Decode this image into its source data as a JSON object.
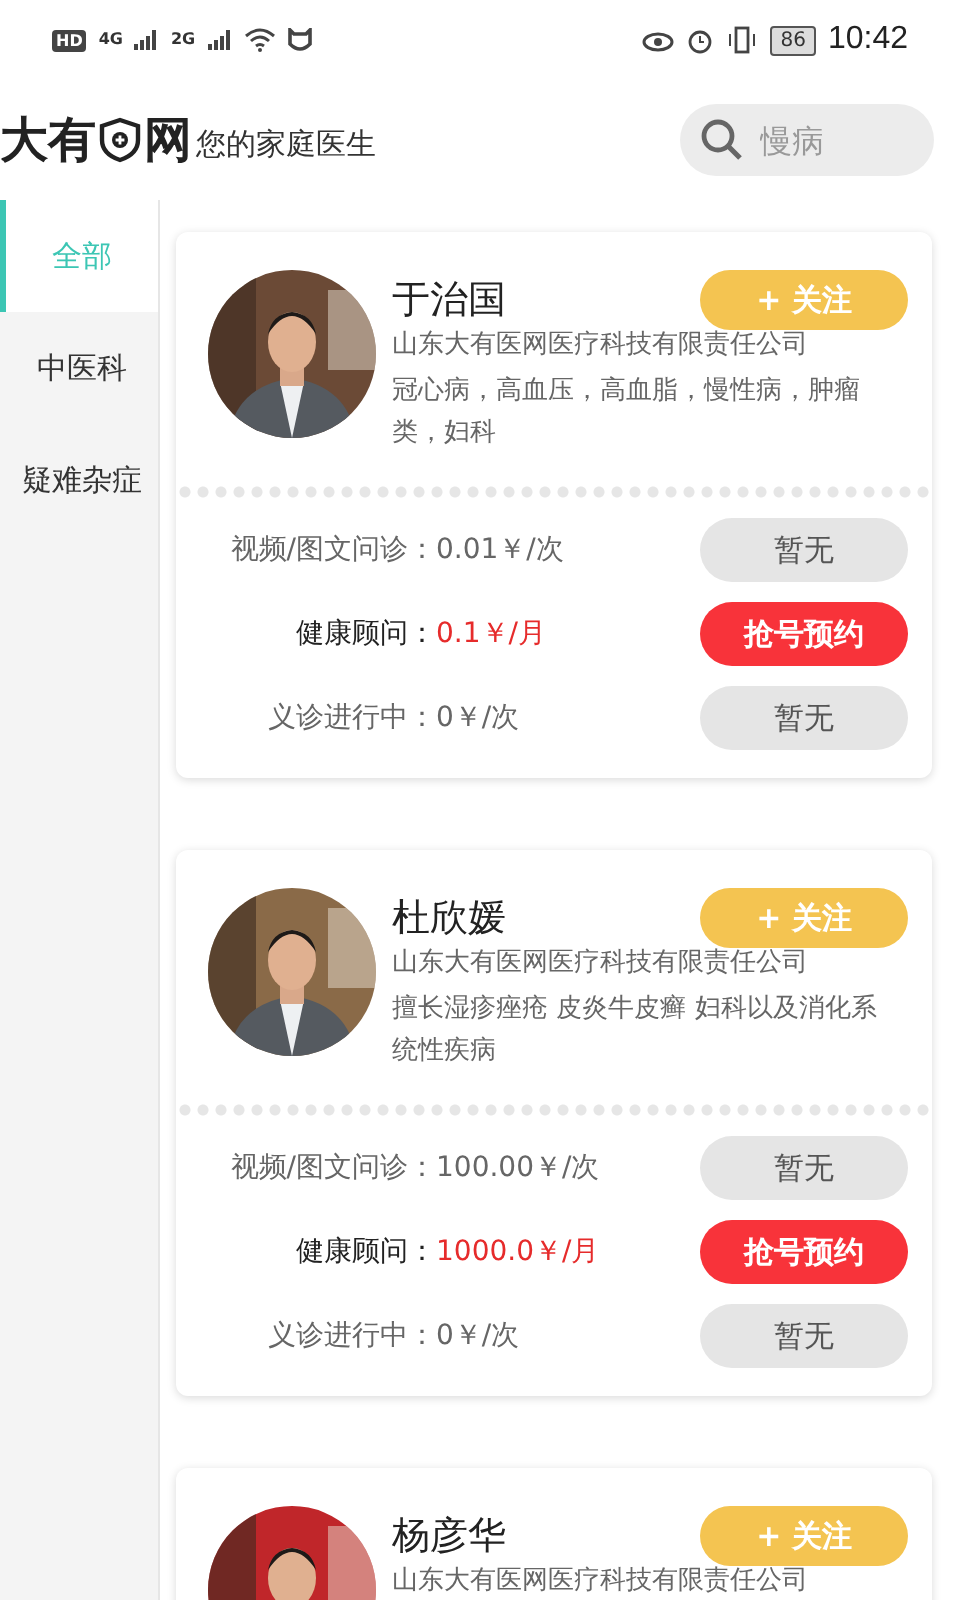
{
  "status_bar": {
    "hd": "HD",
    "networks": [
      "4G",
      "2G"
    ],
    "battery": "86",
    "time": "10:42"
  },
  "header": {
    "logo_left": "大有",
    "logo_right": "网",
    "slogan": "您的家庭医生",
    "search": {
      "placeholder": "慢病"
    }
  },
  "sidebar": {
    "items": [
      {
        "label": "全部",
        "selected": true
      },
      {
        "label": "中医科",
        "selected": false
      },
      {
        "label": "疑难杂症",
        "selected": false
      }
    ]
  },
  "doctors": [
    {
      "name": "于治国",
      "follow": "+ 关注",
      "company": "山东大有医网医疗科技有限责任公司",
      "specialty": "冠心病，高血压，高血脂，慢性病，肿瘤类，妇科",
      "services": [
        {
          "label": "视频/图文问诊：",
          "price": "0.01￥/次",
          "highlight": false,
          "action": "暂无",
          "available": false
        },
        {
          "label": "健康顾问：",
          "price": "0.1￥/月",
          "highlight": true,
          "action": "抢号预约",
          "available": true
        },
        {
          "label": "义诊进行中：",
          "price": "0￥/次",
          "highlight": false,
          "action": "暂无",
          "available": false
        }
      ]
    },
    {
      "name": "杜欣媛",
      "follow": "+ 关注",
      "company": "山东大有医网医疗科技有限责任公司",
      "specialty": "擅长湿疹痤疮 皮炎牛皮癣 妇科以及消化系统性疾病",
      "services": [
        {
          "label": "视频/图文问诊：",
          "price": "100.00￥/次",
          "highlight": false,
          "action": "暂无",
          "available": false
        },
        {
          "label": "健康顾问：",
          "price": "1000.0￥/月",
          "highlight": true,
          "action": "抢号预约",
          "available": true
        },
        {
          "label": "义诊进行中：",
          "price": "0￥/次",
          "highlight": false,
          "action": "暂无",
          "available": false
        }
      ]
    },
    {
      "name": "杨彦华",
      "follow": "+ 关注",
      "company": "山东大有医网医疗科技有限责任公司"
    }
  ]
}
